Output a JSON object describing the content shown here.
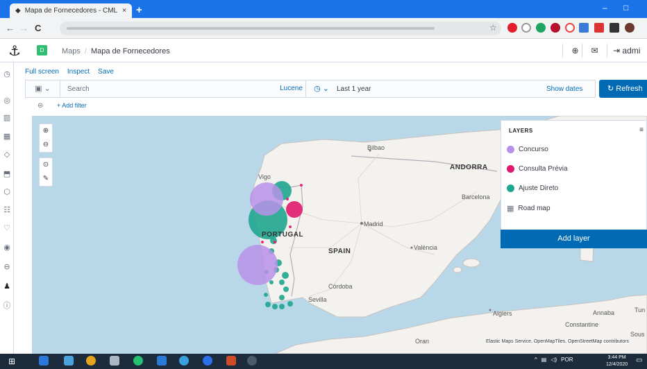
{
  "browser": {
    "tab_title": "Mapa de Fornecedores - CML A",
    "tab_close": "×",
    "new_tab": "+",
    "nav": {
      "back": "←",
      "forward": "→",
      "reload": "C"
    },
    "star": "☆",
    "window_controls": {
      "minimize": "–",
      "maximize": "□"
    }
  },
  "header": {
    "app_icon": "anchor-logo-icon",
    "space_badge": "D",
    "breadcrumb": [
      "Maps",
      "Mapa de Fornecedores"
    ],
    "user_label": "admi"
  },
  "toolbar": {
    "links": [
      "Full screen",
      "Inspect",
      "Save"
    ],
    "search_placeholder": "Search",
    "lucene": "Lucene",
    "time_range": "Last 1 year",
    "show_dates": "Show dates",
    "refresh": "Refresh",
    "add_filter": "+ Add filter"
  },
  "layers_panel": {
    "title": "LAYERS",
    "items": [
      {
        "label": "Concurso",
        "color": "#b792e8"
      },
      {
        "label": "Consulta Prévia",
        "color": "#e0186e"
      },
      {
        "label": "Ajuste Direto",
        "color": "#1fa68f"
      },
      {
        "label": "Road map",
        "color": ""
      }
    ],
    "add_layer": "Add layer"
  },
  "map": {
    "place_labels": [
      "Bilbao",
      "ANDORRA",
      "Barcelona",
      "Vigo",
      "Madrid",
      "PORTUGAL",
      "SPAIN",
      "València",
      "Córdoba",
      "Sevilla",
      "Algiers",
      "Annaba",
      "Tun",
      "Constantine",
      "Sous",
      "Oran"
    ],
    "attribution": "Elastic Maps Service, OpenMapTiles, OpenStreetMap contributors"
  },
  "taskbar": {
    "tray": [
      "^",
      "POR"
    ],
    "time": "3:44 PM",
    "date": "12/4/2020"
  }
}
